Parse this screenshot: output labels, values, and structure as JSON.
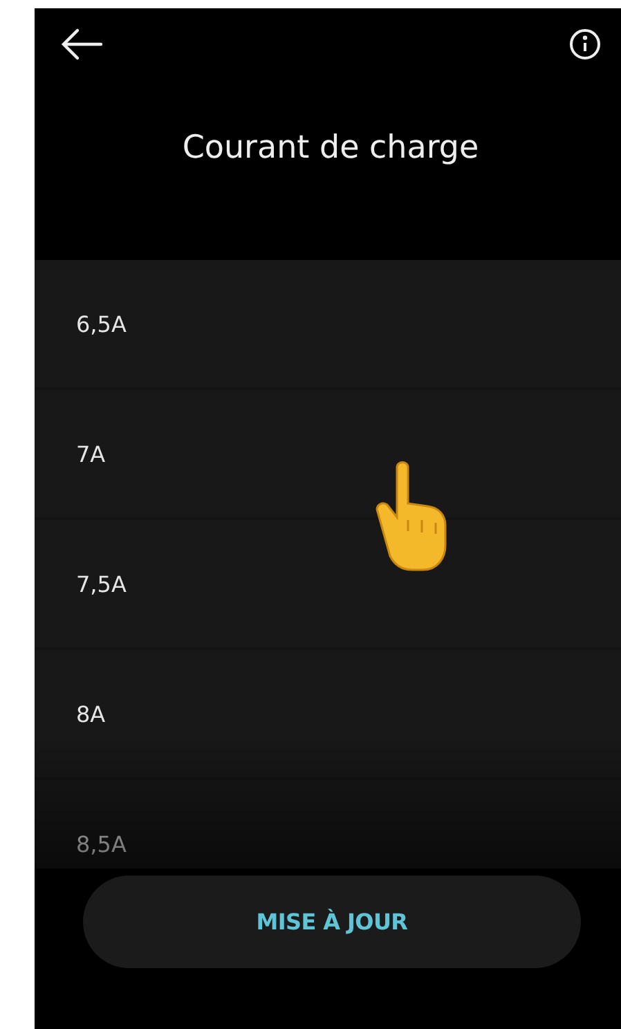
{
  "header": {
    "title": "Courant de charge"
  },
  "options": [
    {
      "label": "6,5A"
    },
    {
      "label": "7A"
    },
    {
      "label": "7,5A"
    },
    {
      "label": "8A"
    },
    {
      "label": "8,5A"
    }
  ],
  "footer": {
    "button": "MISE À JOUR"
  }
}
